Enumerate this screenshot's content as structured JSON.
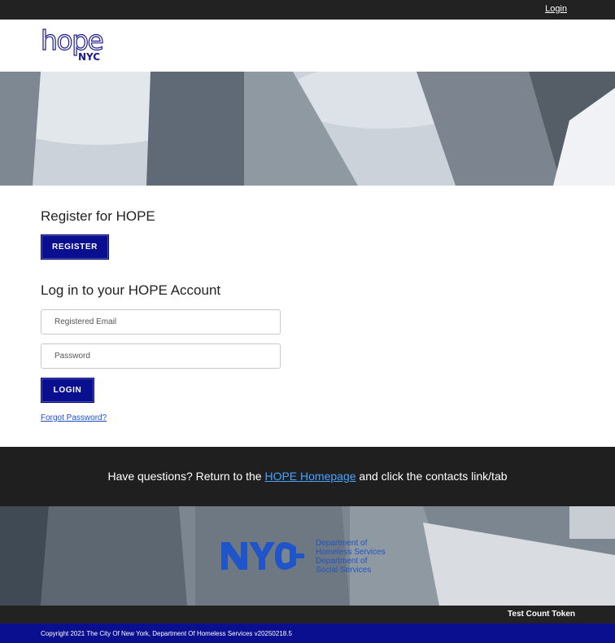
{
  "topbar": {
    "login_link": "Login"
  },
  "header": {
    "logo_word": "hope",
    "logo_sub": "NYC"
  },
  "register": {
    "heading": "Register for HOPE",
    "button": "REGISTER"
  },
  "login": {
    "heading": "Log in to your HOPE Account",
    "email_placeholder": "Registered Email",
    "password_placeholder": "Password",
    "button": "LOGIN",
    "forgot_link": "Forgot Password?"
  },
  "questions": {
    "before": "Have questions? Return to the",
    "link": "HOPE Homepage",
    "after": "and click the contacts link/tab"
  },
  "footer_logo": {
    "mark": "NYC",
    "line1": "Department of",
    "line2": "Homeless Services",
    "line3": "Department of",
    "line4": "Social Services"
  },
  "token_bar": {
    "label": "Test Count Token"
  },
  "copyright": {
    "text": "Copyright 2021 The City Of New York, Department Of Homeless Services v20250218.5"
  },
  "colors": {
    "accent": "#0a0f8f",
    "dark_bar": "#222222",
    "link": "#1a4fd0"
  }
}
